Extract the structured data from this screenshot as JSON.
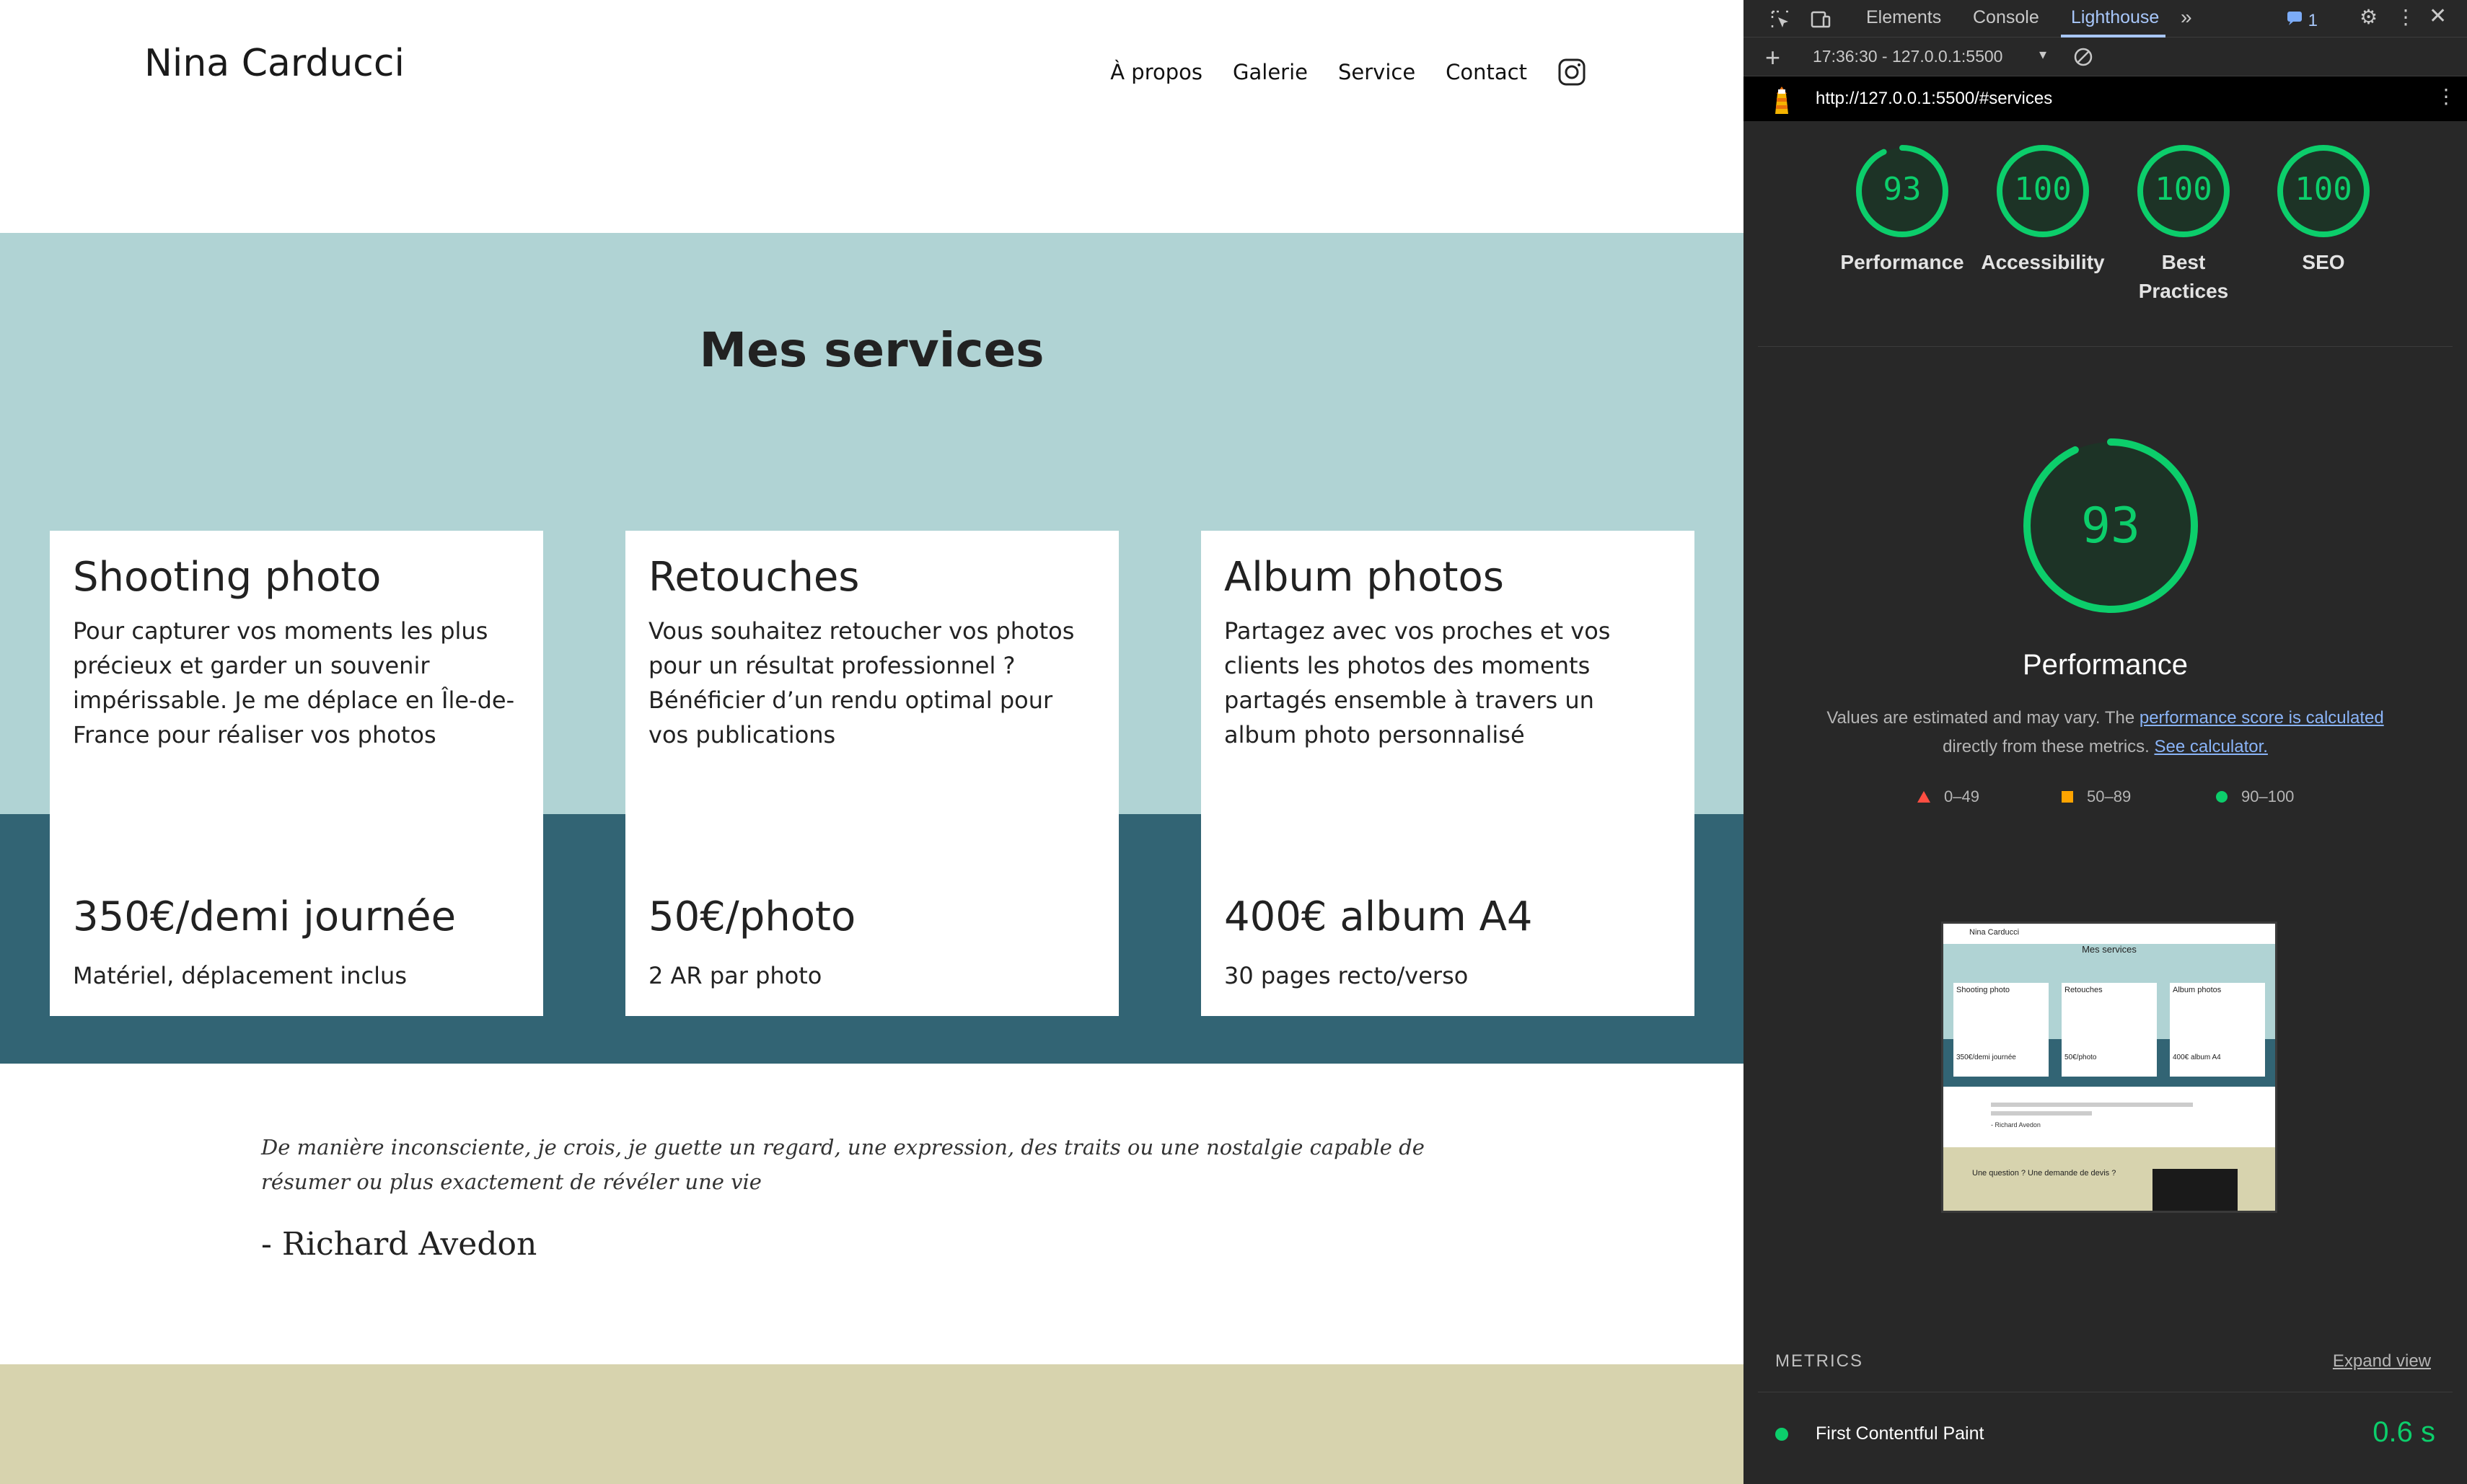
{
  "site": {
    "brand": "Nina Carducci",
    "nav": [
      "À propos",
      "Galerie",
      "Service",
      "Contact"
    ],
    "services_title": "Mes services",
    "cards": [
      {
        "title": "Shooting photo",
        "desc": "Pour capturer vos moments les plus précieux et garder un souvenir impérissable. Je me déplace en Île-de-France pour réaliser vos photos",
        "price": "350€/demi journée",
        "note": "Matériel, déplacement inclus"
      },
      {
        "title": "Retouches",
        "desc": "Vous souhaitez retoucher vos photos pour un résultat professionnel ? Bénéficier d’un rendu optimal pour vos publications",
        "price": "50€/photo",
        "note": "2 AR par photo"
      },
      {
        "title": "Album photos",
        "desc": "Partagez avec vos proches et vos clients les photos des moments partagés ensemble à travers un album photo personnalisé",
        "price": "400€ album A4",
        "note": "30 pages recto/verso"
      }
    ],
    "quote": "De manière inconsciente, je crois, je guette un regard, une expression, des traits ou une nostalgie capable de résumer ou plus exactement de révéler une vie",
    "quote_author": "- Richard Avedon",
    "colors": {
      "services_bg": "#b0d3d4",
      "services_dark": "#326474",
      "contact_bg": "#d7d3ae"
    }
  },
  "devtools": {
    "tabs": [
      "Elements",
      "Console",
      "Lighthouse"
    ],
    "active_tab": "Lighthouse",
    "issues_count": "1",
    "report_selector": "17:36:30 - 127.0.0.1:5500",
    "url": "http://127.0.0.1:5500/#services",
    "scores": [
      {
        "label": "Performance",
        "score": 93
      },
      {
        "label": "Accessibility",
        "score": 100
      },
      {
        "label": "Best Practices",
        "score": 100
      },
      {
        "label": "SEO",
        "score": 100
      }
    ],
    "big_score": {
      "label": "Performance",
      "score": 93
    },
    "note_prefix": "Values are estimated and may vary. The ",
    "note_link1": "performance score is calculated",
    "note_mid": " directly from these metrics. ",
    "note_link2": "See calculator.",
    "legend": [
      {
        "range": "0–49",
        "shape": "triangle",
        "color": "#ff4e42"
      },
      {
        "range": "50–89",
        "shape": "square",
        "color": "#ffa400"
      },
      {
        "range": "90–100",
        "shape": "circle",
        "color": "#0cce6b"
      }
    ],
    "metrics_heading": "METRICS",
    "expand_label": "Expand view",
    "metrics": [
      {
        "name": "First Contentful Paint",
        "value": "0.6 s"
      }
    ],
    "thumbnail": {
      "brand": "Nina Carducci",
      "section_title": "Mes services",
      "cards": [
        {
          "title": "Shooting photo",
          "price": "350€/demi journée"
        },
        {
          "title": "Retouches",
          "price": "50€/photo"
        },
        {
          "title": "Album photos",
          "price": "400€ album A4"
        }
      ],
      "author": "- Richard Avedon",
      "contact_heading": "Une question ? Une demande de devis ?"
    }
  }
}
